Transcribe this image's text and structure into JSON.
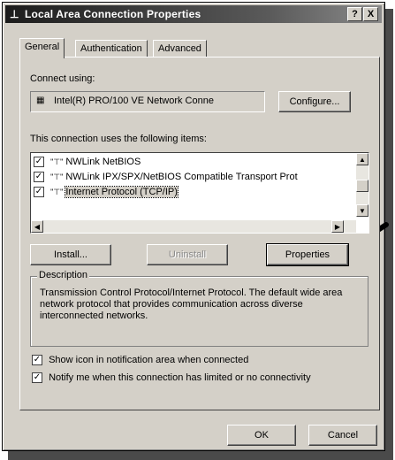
{
  "window": {
    "title": "Local Area Connection Properties",
    "help_label": "?",
    "close_label": "X"
  },
  "tabs": [
    "General",
    "Authentication",
    "Advanced"
  ],
  "general": {
    "connect_using_label": "Connect using:",
    "adapter_name": "Intel(R) PRO/100 VE Network Conne",
    "configure_label": "Configure...",
    "items_label": "This connection uses the following items:",
    "items": [
      {
        "label": "NWLink NetBIOS",
        "checked": true
      },
      {
        "label": "NWLink IPX/SPX/NetBIOS Compatible Transport Prot",
        "checked": true
      },
      {
        "label": "Internet Protocol (TCP/IP)",
        "checked": true,
        "selected": true
      }
    ],
    "install_label": "Install...",
    "uninstall_label": "Uninstall",
    "properties_label": "Properties",
    "description_title": "Description",
    "description_text": "Transmission Control Protocol/Internet Protocol. The default wide area network protocol that provides communication across diverse interconnected networks.",
    "show_icon_label": "Show icon in notification area when connected",
    "notify_label": "Notify me when this connection has limited or no connectivity",
    "show_icon_checked": true,
    "notify_checked": true
  },
  "footer": {
    "ok_label": "OK",
    "cancel_label": "Cancel"
  },
  "icons": {
    "title_icon": "network-connection-icon",
    "adapter_icon": "network-card-icon",
    "item_icon": "network-protocol-icon"
  }
}
